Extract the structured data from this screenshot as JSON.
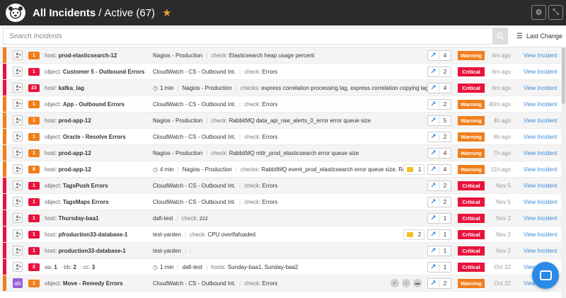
{
  "header": {
    "title": "All Incidents",
    "separator": "/",
    "subtitle": "Active (67)",
    "star_icon": "star-icon",
    "settings_icon": "gear-icon",
    "collapse_icon": "compress-icon"
  },
  "search": {
    "placeholder": "Search Incidents",
    "sort_label": "Last Change"
  },
  "colors": {
    "warning": "#f07e1b",
    "critical": "#e8123c",
    "count_red": "#e8123c",
    "link": "#3a8ad6"
  },
  "incidents": [
    {
      "sev": "warning",
      "count": "1",
      "subj_key": "host:",
      "subj": "prod-elasticsearch-12",
      "duration": "",
      "source": "Nagios - Production",
      "check_key": "check:",
      "check": "Elasticsearch heap usage percent",
      "comments": "",
      "shares": "4",
      "status": "Warning",
      "time": "4m ago",
      "view": "View Incident"
    },
    {
      "sev": "critical",
      "count": "1",
      "subj_key": "object:",
      "subj": "Customer 5 - Outbound Errors",
      "duration": "",
      "source": "CloudWatch - CS - Outbound Int.",
      "check_key": "check:",
      "check": "Errors",
      "comments": "",
      "shares": "2",
      "status": "Critical",
      "time": "6m ago",
      "view": "View Incident"
    },
    {
      "sev": "critical",
      "count": "23",
      "subj_key": "host:",
      "subj": "kafka_lag",
      "duration": "1 min",
      "source": "Nagios - Production",
      "check_key": "checks:",
      "check": "express correlation processing lag, express correlation copying lag ...",
      "comments": "",
      "shares": "4",
      "status": "Critical",
      "time": "6m ago",
      "view": "View Incident"
    },
    {
      "sev": "warning",
      "count": "1",
      "subj_key": "object:",
      "subj": "App - Outbound Errors",
      "duration": "",
      "source": "CloudWatch - CS - Outbound Int.",
      "check_key": "check:",
      "check": "Errors",
      "comments": "",
      "shares": "2",
      "status": "Warning",
      "time": "40m ago",
      "view": "View Incident"
    },
    {
      "sev": "warning",
      "count": "1",
      "subj_key": "host:",
      "subj": "prod-app-12",
      "duration": "",
      "source": "Nagios - Production",
      "check_key": "check:",
      "check": "RabbitMQ data_api_raw_alerts_0_error error queue size",
      "comments": "",
      "shares": "5",
      "status": "Warning",
      "time": "4h ago",
      "view": "View Incident"
    },
    {
      "sev": "warning",
      "count": "1",
      "subj_key": "object:",
      "subj": "Oracle - Resolve Errors",
      "duration": "",
      "source": "CloudWatch - CS - Outbound Int.",
      "check_key": "check:",
      "check": "Errors",
      "comments": "",
      "shares": "2",
      "status": "Warning",
      "time": "6h ago",
      "view": "View Incident"
    },
    {
      "sev": "warning",
      "count": "1",
      "subj_key": "host:",
      "subj": "prod-app-12",
      "duration": "",
      "source": "Nagios - Production",
      "check_key": "check:",
      "check": "RabbitMQ mttr_prod_elasticsearch error queue size",
      "comments": "",
      "shares": "4",
      "status": "Warning",
      "time": "7h ago",
      "view": "View Incident"
    },
    {
      "sev": "warning",
      "count": "8",
      "subj_key": "host:",
      "subj": "prod-app-12",
      "duration": "4 min",
      "source": "Nagios - Production",
      "check_key": "checks:",
      "check": "RabbitMQ event_prod_elasticsearch error queue size, Rab...",
      "comments": "1",
      "shares": "4",
      "status": "Warning",
      "time": "11h ago",
      "view": "View Incident"
    },
    {
      "sev": "critical",
      "count": "1",
      "subj_key": "object:",
      "subj": "TagsPush Errors",
      "duration": "",
      "source": "CloudWatch - CS - Outbound Int.",
      "check_key": "check:",
      "check": "Errors",
      "comments": "",
      "shares": "2",
      "status": "Critical",
      "time": "Nov 5",
      "view": "View Incident"
    },
    {
      "sev": "critical",
      "count": "1",
      "subj_key": "object:",
      "subj": "TagsMaps Errors",
      "duration": "",
      "source": "CloudWatch - CS - Outbound Int.",
      "check_key": "check:",
      "check": "Errors",
      "comments": "",
      "shares": "2",
      "status": "Critical",
      "time": "Nov 5",
      "view": "View Incident"
    },
    {
      "sev": "critical",
      "count": "1",
      "subj_key": "host:",
      "subj": "Thursday-baa1",
      "duration": "",
      "source": "dafi-test",
      "check_key": "check:",
      "check": "zzz",
      "comments": "",
      "shares": "1",
      "status": "Critical",
      "time": "Nov 2",
      "view": "View Incident"
    },
    {
      "sev": "critical",
      "count": "1",
      "subj_key": "host:",
      "subj": "pfroduction33-database-1",
      "duration": "",
      "source": "test-yarden",
      "check_key": "check:",
      "check": "CPU overlfafoaded",
      "comments": "2",
      "shares": "1",
      "status": "Critical",
      "time": "Nov 2",
      "view": "View Incident"
    },
    {
      "sev": "critical",
      "count": "1",
      "subj_key": "host:",
      "subj": "production33-database-1",
      "duration": "",
      "source": "test-yarden",
      "check_key": ":",
      "check": "",
      "comments": "",
      "shares": "1",
      "status": "Critical",
      "time": "Nov 2",
      "view": "View Incident"
    },
    {
      "sev": "critical",
      "count": "2",
      "subj_key": "",
      "subj": "",
      "subj_multi": [
        [
          "aa:",
          "1"
        ],
        [
          "bb:",
          "2"
        ],
        [
          "cc:",
          "3"
        ]
      ],
      "duration": "1 min",
      "source": "dafi-test",
      "check_key": "hosts:",
      "check": "Sunday-baa1, Sunday-baa2",
      "comments": "",
      "shares": "1",
      "status": "Critical",
      "time": "Oct 22",
      "view": "View I"
    },
    {
      "sev": "warning",
      "count": "1",
      "subj_key": "object:",
      "subj": "Move - Remedy Errors",
      "duration": "",
      "source": "CloudWatch - CS - Outbound Int.",
      "check_key": "check:",
      "check": "Errors",
      "comments": "",
      "shares": "2",
      "status": "Warning",
      "time": "Oct 22",
      "view": "View I",
      "avatar": "ab",
      "actions": true
    }
  ]
}
